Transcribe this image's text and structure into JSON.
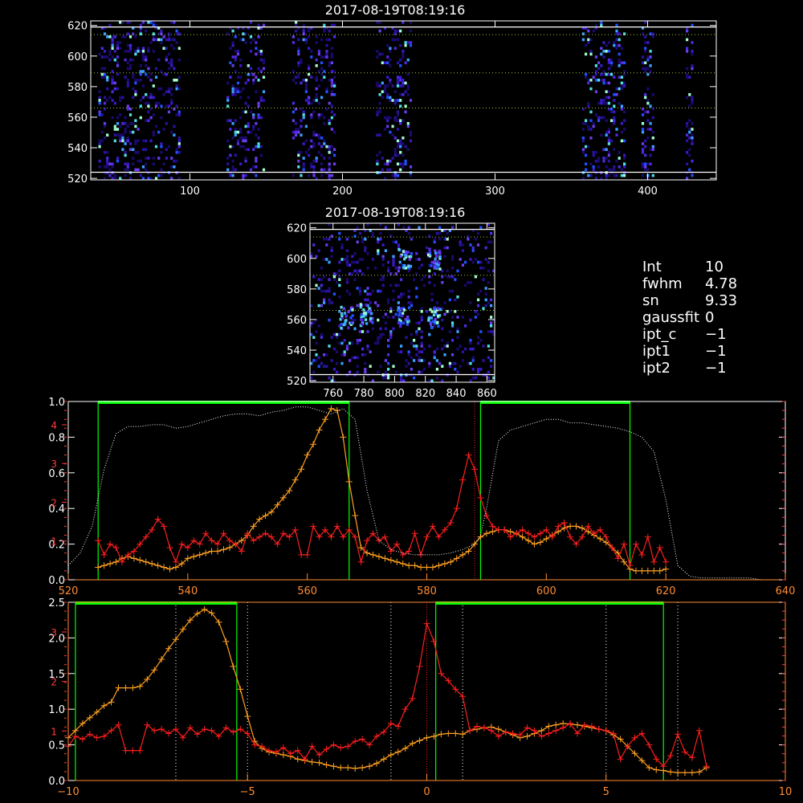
{
  "colors": {
    "frame": "#ffffff",
    "red": "#ff1e1e",
    "orange": "#ffa020",
    "green": "#00ff00",
    "white": "#ffffff",
    "orange_axis": "#ff8c32",
    "red_axis": "#ff3c3c"
  },
  "params": [
    {
      "key": "Int",
      "value": "10"
    },
    {
      "key": "fwhm",
      "value": "4.78"
    },
    {
      "key": "sn",
      "value": "9.33"
    },
    {
      "key": "gaussfit",
      "value": "0"
    },
    {
      "key": "ipt_c",
      "value": "−1"
    },
    {
      "key": "ipt1",
      "value": "−1"
    },
    {
      "key": "ipt2",
      "value": "−1"
    }
  ],
  "chart_data": [
    {
      "type": "heatmap",
      "title": "2017-08-19T08:19:16",
      "xlim": [
        35,
        445
      ],
      "ylim": [
        519,
        623
      ],
      "xticks": [
        100,
        200,
        300,
        400
      ],
      "yticks": [
        520,
        540,
        560,
        580,
        600,
        620
      ],
      "solid_lines_y": [
        524,
        619
      ],
      "dotted_lines_y": [
        566,
        589,
        614
      ],
      "bands": [
        [
          40,
          93
        ],
        [
          124,
          148
        ],
        [
          167,
          195
        ],
        [
          222,
          245
        ],
        [
          357,
          384
        ],
        [
          396,
          404
        ],
        [
          425,
          430
        ]
      ]
    },
    {
      "type": "heatmap",
      "title": "2017-08-19T08:19:16",
      "xlim": [
        745,
        865
      ],
      "ylim": [
        519,
        623
      ],
      "xticks": [
        760,
        780,
        800,
        820,
        840,
        860
      ],
      "yticks": [
        520,
        540,
        560,
        580,
        600,
        620
      ],
      "solid_lines_y": [
        524,
        619
      ],
      "dotted_lines_y": [
        566,
        589,
        614
      ]
    },
    {
      "type": "line",
      "xlim": [
        520,
        640
      ],
      "ylim": [
        0,
        1.0
      ],
      "xticks": [
        520,
        540,
        560,
        580,
        600,
        620,
        640
      ],
      "yticks_left": [
        "0.0",
        "0.2",
        "0.4",
        "0.6",
        "0.8",
        "1.0"
      ],
      "yticks_left_outer": [
        "1",
        "2",
        "3",
        "4"
      ],
      "green_windows": [
        [
          525,
          567
        ],
        [
          589,
          614
        ]
      ],
      "red_dotted_x": [
        588
      ],
      "series": [
        {
          "x": [
            525,
            526,
            527,
            528,
            529,
            530,
            531,
            532,
            533,
            534,
            535,
            536,
            537,
            538,
            539,
            540,
            541,
            542,
            543,
            544,
            545,
            546,
            547,
            548,
            549,
            550,
            551,
            552,
            553,
            554,
            555,
            556,
            557,
            558,
            559,
            560,
            561,
            562,
            563,
            564,
            565,
            566,
            567,
            568,
            569,
            570,
            571,
            572,
            573,
            574,
            575,
            576,
            577,
            578,
            579,
            580,
            581,
            582,
            583,
            584,
            585,
            586,
            587,
            588,
            589,
            590,
            591,
            592,
            593,
            594,
            595,
            596,
            597,
            598,
            599,
            600,
            601,
            602,
            603,
            604,
            605,
            606,
            607,
            608,
            609,
            610,
            611,
            612,
            613,
            614,
            615,
            616,
            617,
            618,
            619,
            620
          ],
          "values": [
            0.07,
            0.08,
            0.09,
            0.1,
            0.12,
            0.13,
            0.12,
            0.11,
            0.1,
            0.09,
            0.08,
            0.07,
            0.06,
            0.07,
            0.09,
            0.12,
            0.13,
            0.14,
            0.15,
            0.16,
            0.16,
            0.17,
            0.18,
            0.2,
            0.22,
            0.25,
            0.3,
            0.34,
            0.36,
            0.38,
            0.42,
            0.46,
            0.5,
            0.56,
            0.62,
            0.7,
            0.76,
            0.84,
            0.9,
            0.96,
            0.95,
            0.8,
            0.55,
            0.36,
            0.18,
            0.15,
            0.14,
            0.13,
            0.12,
            0.11,
            0.1,
            0.09,
            0.08,
            0.08,
            0.07,
            0.07,
            0.07,
            0.08,
            0.09,
            0.1,
            0.12,
            0.14,
            0.16,
            0.2,
            0.24,
            0.26,
            0.27,
            0.28,
            0.28,
            0.27,
            0.26,
            0.24,
            0.22,
            0.2,
            0.21,
            0.23,
            0.25,
            0.27,
            0.29,
            0.3,
            0.3,
            0.29,
            0.27,
            0.25,
            0.23,
            0.21,
            0.18,
            0.15,
            0.1,
            0.06,
            0.05,
            0.05,
            0.05,
            0.05,
            0.05,
            0.06
          ]
        },
        {
          "x": [
            525,
            526,
            527,
            528,
            529,
            530,
            531,
            532,
            533,
            534,
            535,
            536,
            537,
            538,
            539,
            540,
            541,
            542,
            543,
            544,
            545,
            546,
            547,
            548,
            549,
            550,
            551,
            552,
            553,
            554,
            555,
            556,
            557,
            558,
            559,
            560,
            561,
            562,
            563,
            564,
            565,
            566,
            567,
            568,
            569,
            570,
            571,
            572,
            573,
            574,
            575,
            576,
            577,
            578,
            579,
            580,
            581,
            582,
            583,
            584,
            585,
            586,
            587,
            588,
            589,
            590,
            591,
            592,
            593,
            594,
            595,
            596,
            597,
            598,
            599,
            600,
            601,
            602,
            603,
            604,
            605,
            606,
            607,
            608,
            609,
            610,
            611,
            612,
            613,
            614,
            615,
            616,
            617,
            618,
            619,
            620
          ],
          "values": [
            0.22,
            0.14,
            0.2,
            0.18,
            0.1,
            0.14,
            0.16,
            0.2,
            0.24,
            0.28,
            0.34,
            0.3,
            0.18,
            0.1,
            0.2,
            0.18,
            0.22,
            0.2,
            0.26,
            0.22,
            0.2,
            0.26,
            0.22,
            0.2,
            0.16,
            0.26,
            0.22,
            0.24,
            0.26,
            0.24,
            0.2,
            0.26,
            0.24,
            0.28,
            0.14,
            0.14,
            0.3,
            0.24,
            0.28,
            0.24,
            0.3,
            0.24,
            0.28,
            0.24,
            0.1,
            0.22,
            0.26,
            0.22,
            0.24,
            0.16,
            0.2,
            0.14,
            0.16,
            0.26,
            0.14,
            0.24,
            0.3,
            0.24,
            0.28,
            0.32,
            0.4,
            0.56,
            0.7,
            0.62,
            0.46,
            0.36,
            0.3,
            0.28,
            0.28,
            0.24,
            0.26,
            0.28,
            0.26,
            0.24,
            0.26,
            0.28,
            0.24,
            0.3,
            0.32,
            0.24,
            0.2,
            0.24,
            0.3,
            0.26,
            0.28,
            0.24,
            0.18,
            0.12,
            0.2,
            0.08,
            0.2,
            0.14,
            0.24,
            0.1,
            0.18,
            0.1
          ]
        },
        {
          "x": [
            520,
            522,
            524,
            526,
            528,
            530,
            532,
            534,
            536,
            538,
            540,
            542,
            544,
            546,
            548,
            550,
            552,
            554,
            556,
            558,
            560,
            562,
            564,
            566,
            568,
            570,
            572,
            574,
            576,
            578,
            580,
            582,
            584,
            586,
            588,
            589,
            590,
            592,
            594,
            596,
            598,
            600,
            602,
            604,
            606,
            608,
            610,
            612,
            614,
            616,
            618,
            620,
            622,
            624,
            626,
            628,
            630,
            632,
            634,
            636,
            638,
            640
          ],
          "values": [
            0.08,
            0.15,
            0.3,
            0.62,
            0.82,
            0.86,
            0.86,
            0.87,
            0.87,
            0.85,
            0.86,
            0.88,
            0.9,
            0.92,
            0.93,
            0.93,
            0.92,
            0.94,
            0.95,
            0.97,
            0.97,
            0.95,
            0.93,
            0.96,
            0.9,
            0.5,
            0.22,
            0.17,
            0.15,
            0.14,
            0.14,
            0.14,
            0.15,
            0.17,
            0.2,
            0.25,
            0.4,
            0.78,
            0.84,
            0.86,
            0.88,
            0.9,
            0.9,
            0.88,
            0.88,
            0.87,
            0.86,
            0.85,
            0.83,
            0.8,
            0.72,
            0.45,
            0.08,
            0.02,
            0.01,
            0.01,
            0.01,
            0.01,
            0.01,
            0.0,
            0.0,
            0.0
          ]
        }
      ]
    },
    {
      "type": "line",
      "xlim": [
        -10,
        10
      ],
      "ylim": [
        0,
        2.5
      ],
      "xticks": [
        -10,
        -5,
        0,
        5,
        10
      ],
      "yticks_left": [
        "0.0",
        "0.5",
        "1.0",
        "1.5",
        "2.0",
        "2.5"
      ],
      "yticks_left_outer": [
        "1",
        "2",
        "3"
      ],
      "green_windows": [
        [
          -9.8,
          -5.3
        ],
        [
          0.25,
          6.6
        ]
      ],
      "red_dotted_x": [
        0
      ],
      "white_dotted_x": [
        -7,
        -5,
        -1,
        1,
        5,
        7
      ],
      "series": [
        {
          "x": [
            -10,
            -9.8,
            -9.6,
            -9.4,
            -9.2,
            -9.0,
            -8.8,
            -8.6,
            -8.4,
            -8.2,
            -8.0,
            -7.8,
            -7.6,
            -7.4,
            -7.2,
            -7.0,
            -6.8,
            -6.6,
            -6.4,
            -6.2,
            -6.0,
            -5.8,
            -5.6,
            -5.4,
            -5.2,
            -5.0,
            -4.8,
            -4.6,
            -4.4,
            -4.2,
            -4.0,
            -3.8,
            -3.6,
            -3.4,
            -3.2,
            -3.0,
            -2.8,
            -2.6,
            -2.4,
            -2.2,
            -2.0,
            -1.8,
            -1.6,
            -1.4,
            -1.2,
            -1.0,
            -0.8,
            -0.6,
            -0.4,
            -0.2,
            0.0,
            0.2,
            0.4,
            0.6,
            0.8,
            1.0,
            1.2,
            1.4,
            1.6,
            1.8,
            2.0,
            2.2,
            2.4,
            2.6,
            2.8,
            3.0,
            3.2,
            3.4,
            3.6,
            3.8,
            4.0,
            4.2,
            4.4,
            4.6,
            4.8,
            5.0,
            5.2,
            5.4,
            5.6,
            5.8,
            6.0,
            6.2,
            6.4,
            6.6,
            6.8,
            7.0,
            7.2,
            7.4,
            7.6,
            7.8
          ],
          "values": [
            0.6,
            0.7,
            0.8,
            0.88,
            0.96,
            1.05,
            1.1,
            1.3,
            1.3,
            1.3,
            1.32,
            1.42,
            1.55,
            1.7,
            1.85,
            1.98,
            2.12,
            2.25,
            2.34,
            2.4,
            2.35,
            2.22,
            1.95,
            1.6,
            1.28,
            0.9,
            0.55,
            0.45,
            0.4,
            0.38,
            0.36,
            0.34,
            0.3,
            0.28,
            0.26,
            0.25,
            0.22,
            0.2,
            0.18,
            0.18,
            0.17,
            0.18,
            0.2,
            0.24,
            0.3,
            0.36,
            0.4,
            0.45,
            0.52,
            0.56,
            0.6,
            0.62,
            0.65,
            0.66,
            0.66,
            0.65,
            0.7,
            0.72,
            0.74,
            0.75,
            0.72,
            0.68,
            0.64,
            0.6,
            0.62,
            0.66,
            0.7,
            0.76,
            0.78,
            0.8,
            0.79,
            0.78,
            0.76,
            0.74,
            0.72,
            0.7,
            0.64,
            0.58,
            0.48,
            0.38,
            0.28,
            0.18,
            0.15,
            0.14,
            0.12,
            0.11,
            0.11,
            0.11,
            0.12,
            0.18
          ]
        },
        {
          "x": [
            -10,
            -9.8,
            -9.6,
            -9.4,
            -9.2,
            -9.0,
            -8.8,
            -8.6,
            -8.4,
            -8.2,
            -8.0,
            -7.8,
            -7.6,
            -7.4,
            -7.2,
            -7.0,
            -6.8,
            -6.6,
            -6.4,
            -6.2,
            -6.0,
            -5.8,
            -5.6,
            -5.4,
            -5.2,
            -5.0,
            -4.8,
            -4.6,
            -4.4,
            -4.2,
            -4.0,
            -3.8,
            -3.6,
            -3.4,
            -3.2,
            -3.0,
            -2.8,
            -2.6,
            -2.4,
            -2.2,
            -2.0,
            -1.8,
            -1.6,
            -1.4,
            -1.2,
            -1.0,
            -0.8,
            -0.6,
            -0.4,
            -0.2,
            0.0,
            0.2,
            0.4,
            0.6,
            0.8,
            1.0,
            1.2,
            1.4,
            1.6,
            1.8,
            2.0,
            2.2,
            2.4,
            2.6,
            2.8,
            3.0,
            3.2,
            3.4,
            3.6,
            3.8,
            4.0,
            4.2,
            4.4,
            4.6,
            4.8,
            5.0,
            5.2,
            5.4,
            5.6,
            5.8,
            6.0,
            6.2,
            6.4,
            6.6,
            6.8,
            7.0,
            7.2,
            7.4,
            7.6,
            7.8
          ],
          "values": [
            0.48,
            0.62,
            0.58,
            0.65,
            0.6,
            0.62,
            0.7,
            0.78,
            0.42,
            0.42,
            0.42,
            0.78,
            0.7,
            0.72,
            0.66,
            0.72,
            0.6,
            0.74,
            0.65,
            0.72,
            0.7,
            0.62,
            0.74,
            0.68,
            0.72,
            0.66,
            0.5,
            0.48,
            0.42,
            0.4,
            0.46,
            0.38,
            0.42,
            0.3,
            0.48,
            0.36,
            0.44,
            0.5,
            0.46,
            0.48,
            0.55,
            0.58,
            0.5,
            0.62,
            0.68,
            0.8,
            0.76,
            1.0,
            1.15,
            1.6,
            2.2,
            1.95,
            1.5,
            1.4,
            1.28,
            1.18,
            0.7,
            0.76,
            0.74,
            0.7,
            0.62,
            0.68,
            0.66,
            0.64,
            0.74,
            0.7,
            0.62,
            0.66,
            0.7,
            0.74,
            0.8,
            0.66,
            0.78,
            0.76,
            0.72,
            0.7,
            0.66,
            0.3,
            0.48,
            0.6,
            0.66,
            0.5,
            0.3,
            0.2,
            0.35,
            0.65,
            0.4,
            0.32,
            0.7,
            0.2
          ]
        }
      ]
    }
  ]
}
